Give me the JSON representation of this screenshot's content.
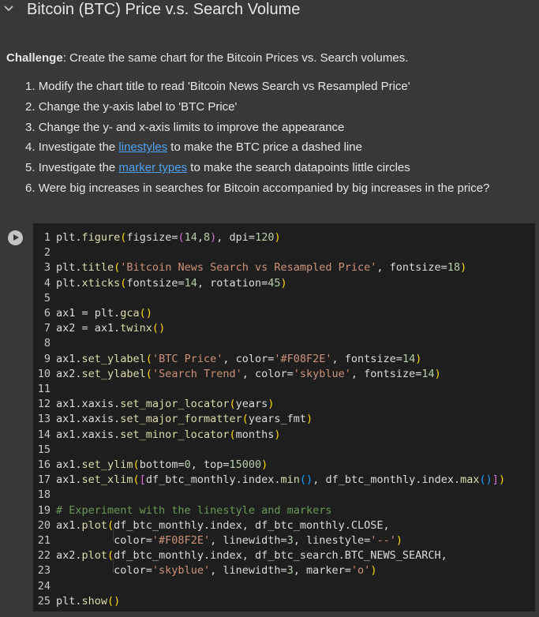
{
  "section": {
    "title": "Bitcoin (BTC) Price v.s. Search Volume"
  },
  "challenge": {
    "label": "Challenge",
    "text": ": Create the same chart for the Bitcoin Prices vs. Search volumes."
  },
  "tasks": [
    {
      "num": "1.",
      "text": "Modify the chart title to read 'Bitcoin News Search vs Resampled Price'"
    },
    {
      "num": "2.",
      "text": "Change the y-axis label to 'BTC Price'"
    },
    {
      "num": "3.",
      "text": "Change the y- and x-axis limits to improve the appearance"
    },
    {
      "num": "4.",
      "pre": "Investigate the ",
      "link": "linestyles",
      "post": " to make the BTC price a dashed line"
    },
    {
      "num": "5.",
      "pre": "Investigate the ",
      "link": "marker types",
      "post": " to make the search datapoints little circles"
    },
    {
      "num": "6.",
      "text": "Were big increases in searches for Bitcoin accompanied by big increases in the price?"
    }
  ],
  "code": {
    "lines": [
      "plt.figure(figsize=(14,8), dpi=120)",
      "",
      "plt.title('Bitcoin News Search vs Resampled Price', fontsize=18)",
      "plt.xticks(fontsize=14, rotation=45)",
      "",
      "ax1 = plt.gca()",
      "ax2 = ax1.twinx()",
      "",
      "ax1.set_ylabel('BTC Price', color='#F08F2E', fontsize=14)",
      "ax2.set_ylabel('Search Trend', color='skyblue', fontsize=14)",
      "",
      "ax1.xaxis.set_major_locator(years)",
      "ax1.xaxis.set_major_formatter(years_fmt)",
      "ax1.xaxis.set_minor_locator(months)",
      "",
      "ax1.set_ylim(bottom=0, top=15000)",
      "ax1.set_xlim([df_btc_monthly.index.min(), df_btc_monthly.index.max()])",
      "",
      "# Experiment with the linestyle and markers",
      "ax1.plot(df_btc_monthly.index, df_btc_monthly.CLOSE,",
      "         color='#F08F2E', linewidth=3, linestyle='--')",
      "ax2.plot(df_btc_monthly.index, df_btc_search.BTC_NEWS_SEARCH,",
      "         color='skyblue', linewidth=3, marker='o')",
      "",
      "plt.show()"
    ]
  }
}
